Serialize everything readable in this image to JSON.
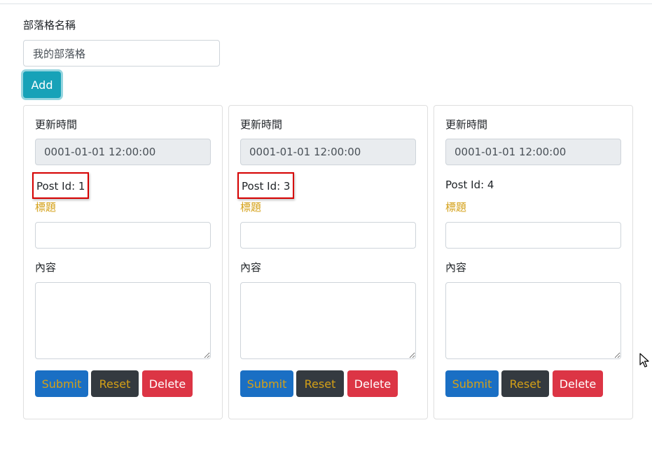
{
  "form": {
    "blog_name_label": "部落格名稱",
    "blog_name_value": "我的部落格",
    "add_label": "Add"
  },
  "cards": [
    {
      "time_label": "更新時間",
      "time_value": "0001-01-01 12:00:00",
      "post_id": "Post Id: 1",
      "title_label": "標題",
      "title_value": "",
      "content_label": "內容",
      "content_value": "",
      "submit_label": "Submit",
      "reset_label": "Reset",
      "delete_label": "Delete"
    },
    {
      "time_label": "更新時間",
      "time_value": "0001-01-01 12:00:00",
      "post_id": "Post Id: 3",
      "title_label": "標題",
      "title_value": "",
      "content_label": "內容",
      "content_value": "",
      "submit_label": "Submit",
      "reset_label": "Reset",
      "delete_label": "Delete"
    },
    {
      "time_label": "更新時間",
      "time_value": "0001-01-01 12:00:00",
      "post_id": "Post Id: 4",
      "title_label": "標題",
      "title_value": "",
      "content_label": "內容",
      "content_value": "",
      "submit_label": "Submit",
      "reset_label": "Reset",
      "delete_label": "Delete"
    }
  ],
  "colors": {
    "add_button": "#17a2b8",
    "submit_button": "#1a6fc4",
    "reset_button": "#343a40",
    "delete_button": "#dc3545",
    "title_label": "#d4a017",
    "highlight_border": "#d60000"
  },
  "icons": {
    "cursor": "mouse-pointer-icon"
  }
}
